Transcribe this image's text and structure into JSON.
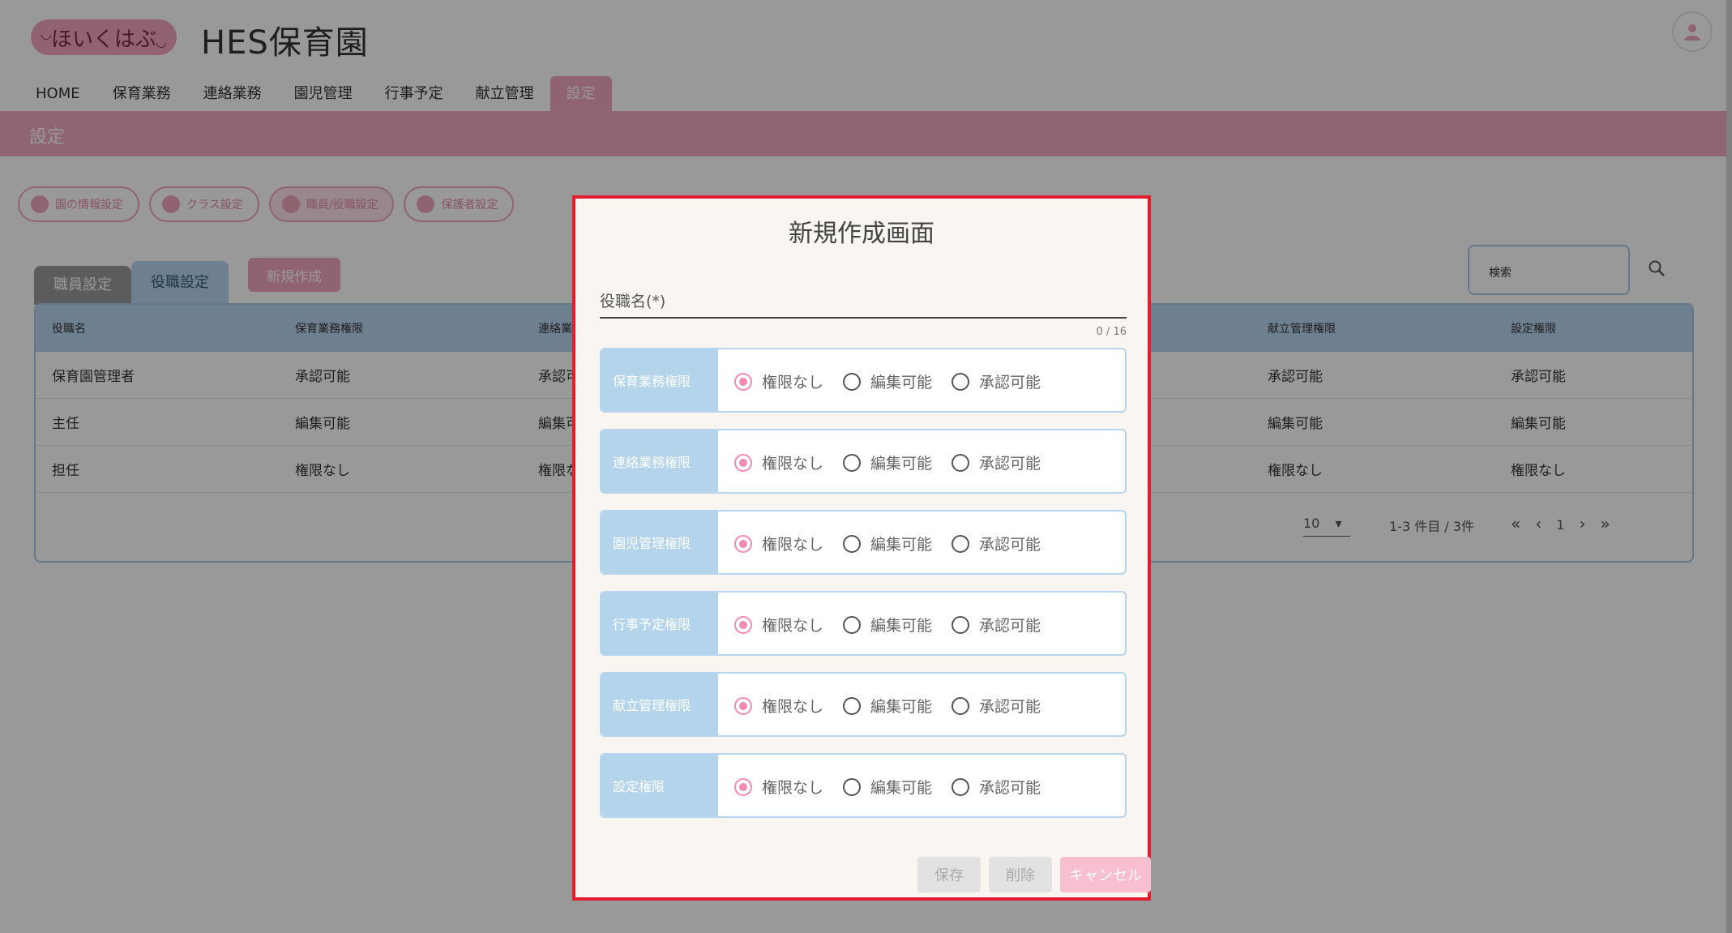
{
  "header": {
    "logo_text": "ほいくはぶ",
    "title": "HES保育園"
  },
  "nav": {
    "items": [
      "HOME",
      "保育業務",
      "連絡業務",
      "園児管理",
      "行事予定",
      "献立管理",
      "設定"
    ]
  },
  "section": {
    "title": "設定"
  },
  "settings_buttons": [
    "園の情報設定",
    "クラス設定",
    "職員/役職設定",
    "保護者設定"
  ],
  "tabs": [
    "職員設定",
    "役職設定"
  ],
  "new_button": "新規作成",
  "search": {
    "label": "検索"
  },
  "table": {
    "headers": [
      "役職名",
      "保育業務権限",
      "連絡業",
      "献立管理権限",
      "設定権限"
    ],
    "rows": [
      [
        "保育園管理者",
        "承認可能",
        "承認可",
        "承認可能",
        "承認可能"
      ],
      [
        "主任",
        "編集可能",
        "編集可",
        "編集可能",
        "編集可能"
      ],
      [
        "担任",
        "権限なし",
        "権限な",
        "権限なし",
        "権限なし"
      ]
    ],
    "pager": {
      "per_page": "10",
      "range": "1-3 件目 / 3件",
      "page": "1"
    }
  },
  "modal": {
    "title": "新規作成画面",
    "field_label": "役職名(*)",
    "counter": "0 / 16",
    "options": [
      "権限なし",
      "編集可能",
      "承認可能"
    ],
    "permissions": [
      {
        "label": "保育業務権限",
        "selected": "権限なし"
      },
      {
        "label": "連絡業務権限",
        "selected": "権限なし"
      },
      {
        "label": "園児管理権限",
        "selected": "権限なし"
      },
      {
        "label": "行事予定権限",
        "selected": "権限なし"
      },
      {
        "label": "献立管理権限",
        "selected": "権限なし"
      },
      {
        "label": "設定権限",
        "selected": "権限なし"
      }
    ],
    "buttons": {
      "save": "保存",
      "delete": "削除",
      "cancel": "キャンセル"
    }
  },
  "colors": {
    "accent_pink": "#f1a6bd",
    "accent_blue": "#b7d5ee",
    "modal_border": "#e11d2f"
  }
}
